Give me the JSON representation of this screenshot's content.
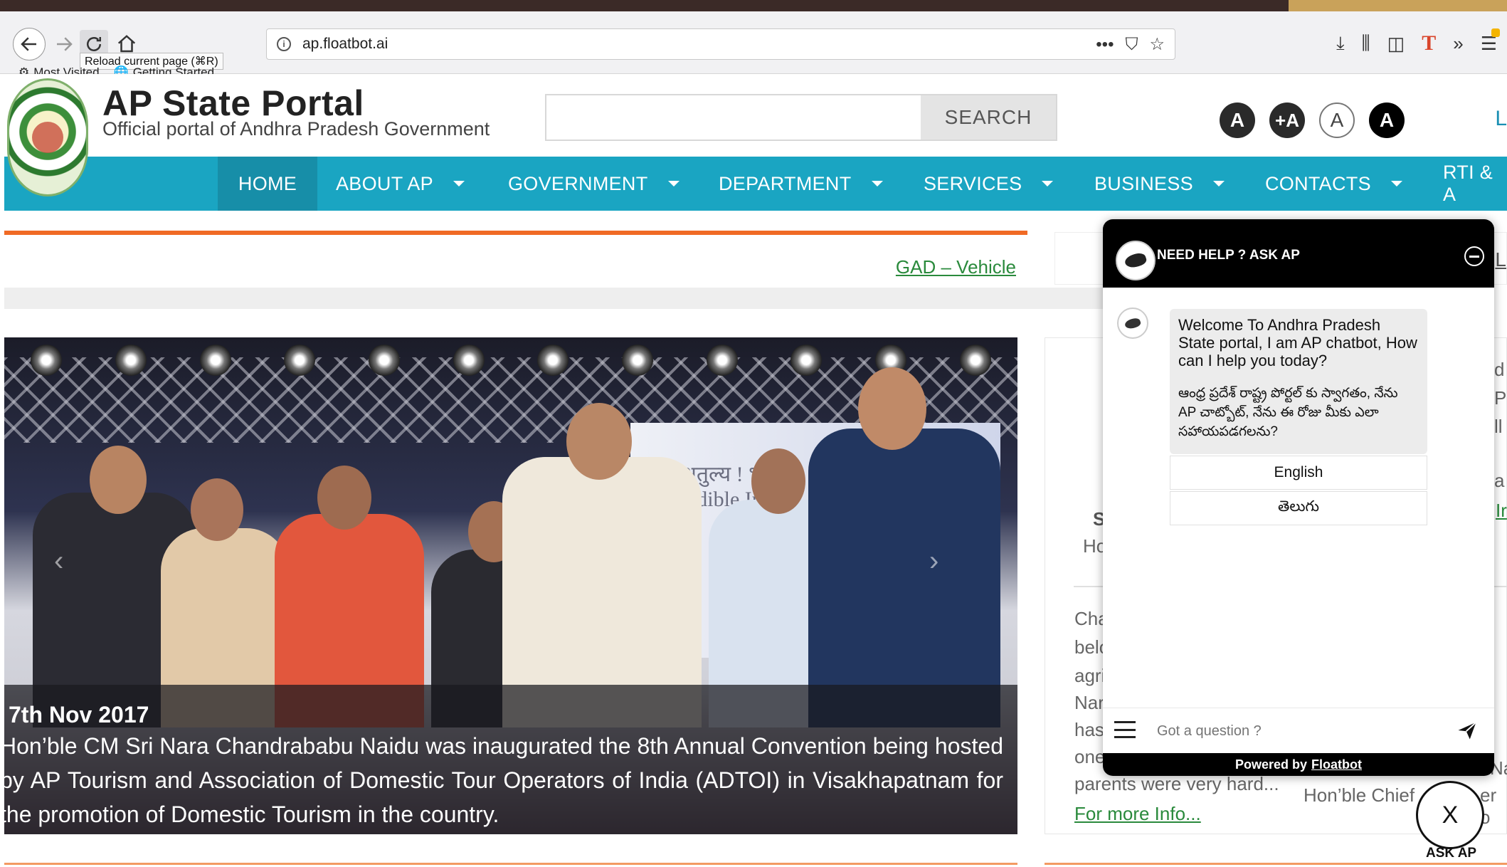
{
  "browser": {
    "tooltip": "Reload current page (⌘R)",
    "bookmarks": [
      "Most Visited",
      "Getting Started"
    ],
    "url": "ap.floatbot.ai",
    "url_actions": "•••"
  },
  "header": {
    "title": "AP State Portal",
    "subtitle": "Official portal of Andhra Pradesh Government",
    "search_placeholder": "",
    "search_button": "SEARCH",
    "font_controls": [
      "A",
      "+A",
      "A",
      "A"
    ],
    "cut_link": "L"
  },
  "nav": {
    "items": [
      {
        "label": "HOME"
      },
      {
        "label": "ABOUT AP"
      },
      {
        "label": "GOVERNMENT"
      },
      {
        "label": "DEPARTMENT"
      },
      {
        "label": "SERVICES"
      },
      {
        "label": "BUSINESS"
      },
      {
        "label": "CONTACTS"
      },
      {
        "label": "RTI & A"
      }
    ]
  },
  "marquee": {
    "link": "GAD – Vehicle"
  },
  "side_top": {
    "cut": "L"
  },
  "slider": {
    "banner_text": "अतुल्य ! भार\nredible In",
    "date": "7th Nov 2017",
    "caption": "Hon’ble CM Sri Nara Chandrababu Naidu was inaugurated the 8th Annual Convention being hosted by AP Tourism and Association of Domestic Tour Operators of India (ADTOI) in Visakhapatnam for the promotion of Domestic Tourism in the country."
  },
  "card": {
    "fragments": [
      "S",
      "Ho",
      "Cha",
      "belo",
      "agri",
      "Nar",
      "has",
      "one",
      "parents were very hard...",
      "d",
      "P",
      "ll",
      "a",
      "Ir",
      "Na",
      "Hon’ble Chief",
      "er o"
    ],
    "more_info": "For more Info..."
  },
  "chat": {
    "title": "NEED HELP ? ASK AP",
    "welcome_en": "Welcome To Andhra Pradesh State portal, I am AP chatbot, How can I help you today?",
    "welcome_te": "ఆంధ్ర ప్రదేశ్ రాష్ట్ర పోర్టల్ కు స్వాగతం, నేను AP చాట్బోట్, నేను ఈ రోజు మీకు ఎలా సహాయపడగలను?",
    "options": [
      "English",
      "తెలుగు"
    ],
    "input_placeholder": "Got a question ?",
    "powered_prefix": "Powered by",
    "powered_brand": "Floatbot",
    "close_label": "X",
    "fab_label": "ASK AP"
  }
}
